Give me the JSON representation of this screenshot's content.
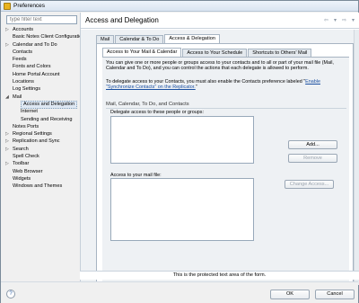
{
  "window": {
    "title": "Preferences"
  },
  "filter": {
    "placeholder": "type filter text"
  },
  "tree": [
    {
      "label": "Accounts",
      "arrow": "▷",
      "child": false,
      "selected": false
    },
    {
      "label": "Basic Notes Client Configuration",
      "arrow": "",
      "child": false,
      "selected": false
    },
    {
      "label": "Calendar and To Do",
      "arrow": "▷",
      "child": false,
      "selected": false
    },
    {
      "label": "Contacts",
      "arrow": "",
      "child": false,
      "selected": false
    },
    {
      "label": "Feeds",
      "arrow": "",
      "child": false,
      "selected": false
    },
    {
      "label": "Fonts and Colors",
      "arrow": "",
      "child": false,
      "selected": false
    },
    {
      "label": "Home Portal Account",
      "arrow": "",
      "child": false,
      "selected": false
    },
    {
      "label": "Locations",
      "arrow": "",
      "child": false,
      "selected": false
    },
    {
      "label": "Log Settings",
      "arrow": "",
      "child": false,
      "selected": false
    },
    {
      "label": "Mail",
      "arrow": "◢",
      "child": false,
      "selected": false
    },
    {
      "label": "Access and Delegation",
      "arrow": "",
      "child": true,
      "selected": true
    },
    {
      "label": "Internet",
      "arrow": "",
      "child": true,
      "selected": false
    },
    {
      "label": "Sending and Receiving",
      "arrow": "",
      "child": true,
      "selected": false
    },
    {
      "label": "Notes Ports",
      "arrow": "",
      "child": false,
      "selected": false
    },
    {
      "label": "Regional Settings",
      "arrow": "▷",
      "child": false,
      "selected": false
    },
    {
      "label": "Replication and Sync",
      "arrow": "▷",
      "child": false,
      "selected": false
    },
    {
      "label": "Search",
      "arrow": "▷",
      "child": false,
      "selected": false
    },
    {
      "label": "Spell Check",
      "arrow": "",
      "child": false,
      "selected": false
    },
    {
      "label": "Toolbar",
      "arrow": "▷",
      "child": false,
      "selected": false
    },
    {
      "label": "Web Browser",
      "arrow": "",
      "child": false,
      "selected": false
    },
    {
      "label": "Widgets",
      "arrow": "",
      "child": false,
      "selected": false
    },
    {
      "label": "Windows and Themes",
      "arrow": "",
      "child": false,
      "selected": false
    }
  ],
  "panel": {
    "title": "Access and Delegation",
    "nav_icons": [
      "⇦",
      "▾",
      "⇨",
      "▾"
    ]
  },
  "tabs_outer": [
    "Mail",
    "Calendar & To Do",
    "Access & Delegation"
  ],
  "tabs_inner": [
    "Access to Your Mail & Calendar",
    "Access to Your Schedule",
    "Shortcuts to Others' Mail"
  ],
  "desc1": "You can give one or more people or groups access to your contacts and to all or part of your mail file (Mail, Calendar and To Do), and you can control the actions that each delegate is allowed to perform.",
  "desc2_prefix": "To delegate access to your Contacts, you must also enable the Contacts preference labeled \"",
  "desc2_link": "Enable \"Synchronize Contacts\" on the Replicator.",
  "desc2_suffix": "\"",
  "section": {
    "title": "Mail, Calendar, To Do, and Contacts"
  },
  "people_label": "Delegate access to these people or groups:",
  "access_label": "Access to your mail file:",
  "buttons": {
    "add": "Add...",
    "remove": "Remove",
    "change": "Change Access...",
    "ok": "OK",
    "cancel": "Cancel"
  },
  "footer_note": "This is the protected text area of the form."
}
